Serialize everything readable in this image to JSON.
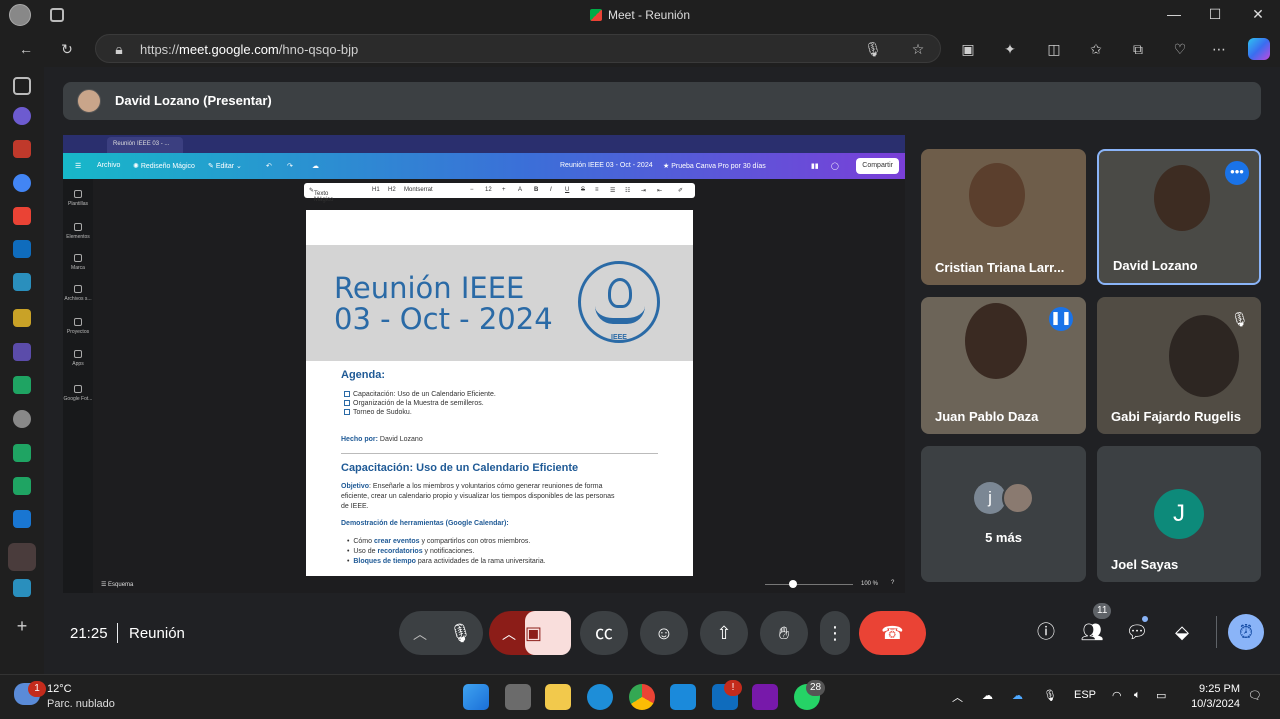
{
  "browser": {
    "window_title": "Meet - Reunión",
    "url_prefix": "https://",
    "url_host": "meet.google.com",
    "url_path": "/hno-qsqo-bjp",
    "min_label": "—",
    "max_label": "☐",
    "close_label": "✕"
  },
  "presenter_bar": {
    "name": "David Lozano (Presentar)"
  },
  "canva": {
    "tab_title": "Reunión IEEE 03 - ...",
    "menu_archivo": "Archivo",
    "menu_redisenio": "Rediseño Mágico",
    "menu_editar": "Editar",
    "doc_title": "Reunión IEEE 03 - Oct - 2024",
    "pro_trial": "Prueba Canva Pro por 30 días",
    "share": "Compartir",
    "left_items": [
      "Plantillas",
      "Elementos",
      "Marca",
      "Archivos s...",
      "Proyectos",
      "Apps",
      "Google Fot..."
    ],
    "fmt_magic": "Texto Mágico",
    "fmt_font": "Montserrat",
    "fmt_size": "12",
    "bottom_notes": "Esquema",
    "zoom": "100 %"
  },
  "document": {
    "title_line1": "Reunión IEEE",
    "title_line2": "03 - Oct - 2024",
    "logo_text": "IEEE",
    "agenda_heading": "Agenda:",
    "agenda_items": [
      "Capacitación: Uso de un Calendario Eficiente.",
      "Organización de la Muestra de semilleros.",
      "Torneo de Sudoku."
    ],
    "made_by_label": "Hecho por:",
    "made_by_name": "David Lozano",
    "section_heading": "Capacitación: Uso de un Calendario Eficiente",
    "objective_label": "Objetivo",
    "objective_text_1": ": Enseñarle a los miembros y voluntarios cómo generar reuniones de forma",
    "objective_text_2": "eficiente, crear un calendario propio y visualizar los tiempos disponibles de las personas",
    "objective_text_3": "de IEEE.",
    "demo_heading": "Demostración de herramientas (Google Calendar):",
    "bullets": [
      {
        "pre": "Cómo ",
        "bold": "crear eventos",
        "post": " y compartirlos con otros miembros."
      },
      {
        "pre": "Uso de ",
        "bold": "recordatorios",
        "post": " y notificaciones."
      },
      {
        "pre": "",
        "bold": "Bloques de tiempo",
        "post": " para actividades de la rama universitaria."
      }
    ]
  },
  "participants": [
    {
      "name": "Cristian Triana Larr..."
    },
    {
      "name": "David Lozano"
    },
    {
      "name": "Juan Pablo Daza"
    },
    {
      "name": "Gabi Fajardo Rugelis"
    },
    {
      "name": "5 más",
      "avatar_letter": "j"
    },
    {
      "name": "Joel Sayas",
      "avatar_letter": "J"
    }
  ],
  "controls": {
    "time": "21:25",
    "meeting_name": "Reunión",
    "people_count": "11"
  },
  "taskbar": {
    "weather_temp": "12°C",
    "weather_desc": "Parc. nublado",
    "weather_badge": "1",
    "lang": "ESP",
    "time": "9:25 PM",
    "date": "10/3/2024",
    "whatsapp_badge": "28",
    "outlook_badge": "!"
  },
  "colors": {
    "accent_blue": "#1a73e8",
    "end_call_red": "#ea4335",
    "cam_off_red": "#8c1d18",
    "doc_blue": "#2a6aa6"
  }
}
